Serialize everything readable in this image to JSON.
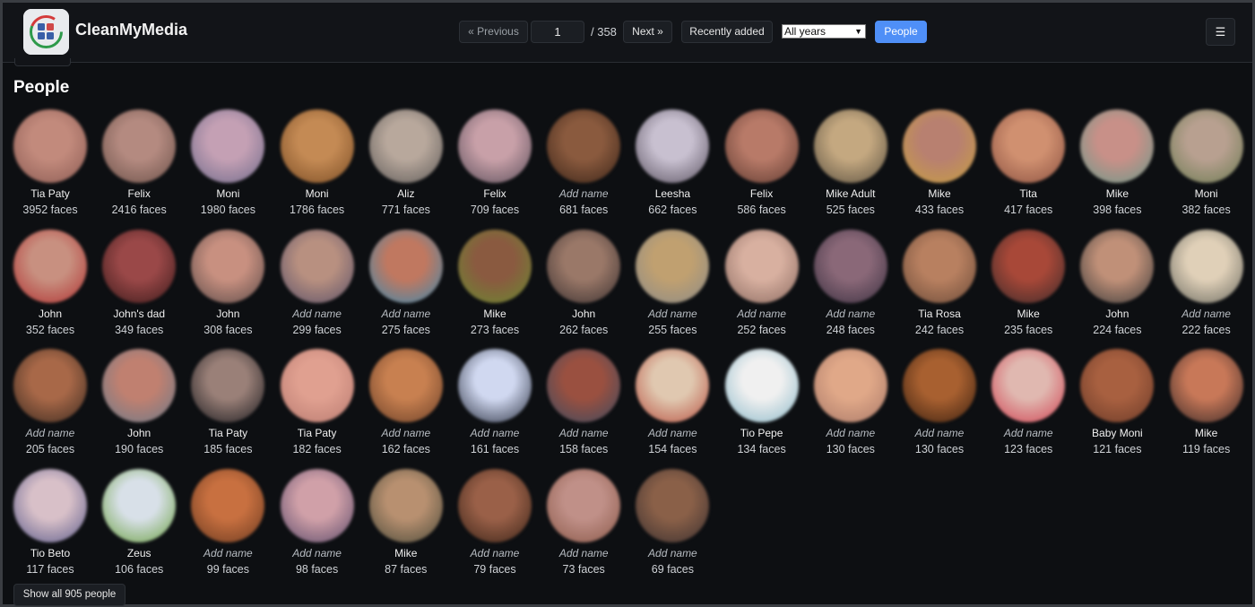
{
  "app": {
    "title": "CleanMyMedia",
    "logo_icon": "app-logo-icon"
  },
  "nav": {
    "previous_label": "« Previous",
    "page_value": "1",
    "total_pages": "/ 358",
    "next_label": "Next »",
    "recently_added_label": "Recently added",
    "year_selected": "All years",
    "people_label": "People",
    "menu_icon": "☰"
  },
  "main": {
    "heading": "People",
    "show_all_label": "Show all 905 people"
  },
  "colors": {
    "accent": "#4f8ff7",
    "background": "#0d0f12",
    "surface": "#1b1e23"
  },
  "people": [
    {
      "name": "Tia Paty",
      "faces": "3952 faces",
      "tone": [
        "#c28a7c",
        "#8a5a52"
      ]
    },
    {
      "name": "Felix",
      "faces": "2416 faces",
      "tone": [
        "#b48a80",
        "#6a5048"
      ]
    },
    {
      "name": "Moni",
      "faces": "1980 faces",
      "tone": [
        "#c4a0b4",
        "#6e6a8a"
      ]
    },
    {
      "name": "Moni",
      "faces": "1786 faces",
      "tone": [
        "#c48a54",
        "#7a4c24"
      ]
    },
    {
      "name": "Aliz",
      "faces": "771 faces",
      "tone": [
        "#b8a89c",
        "#5e5a58"
      ]
    },
    {
      "name": "Felix",
      "faces": "709 faces",
      "tone": [
        "#c8a0a8",
        "#5a4e5a"
      ]
    },
    {
      "name": "",
      "faces": "681 faces",
      "tone": [
        "#8a5a3e",
        "#3a2418"
      ]
    },
    {
      "name": "Leesha",
      "faces": "662 faces",
      "tone": [
        "#c8c0d0",
        "#5a5260"
      ]
    },
    {
      "name": "Felix",
      "faces": "586 faces",
      "tone": [
        "#b87a68",
        "#5e3a30"
      ]
    },
    {
      "name": "Mike Adult",
      "faces": "525 faces",
      "tone": [
        "#c4a880",
        "#5a5040"
      ]
    },
    {
      "name": "Mike",
      "faces": "433 faces",
      "tone": [
        "#b88070",
        "#c8a040"
      ]
    },
    {
      "name": "Tita",
      "faces": "417 faces",
      "tone": [
        "#d09070",
        "#8a5040"
      ]
    },
    {
      "name": "Mike",
      "faces": "398 faces",
      "tone": [
        "#c89088",
        "#6a9a8a"
      ]
    },
    {
      "name": "Moni",
      "faces": "382 faces",
      "tone": [
        "#b8a090",
        "#6a7a50"
      ]
    },
    {
      "name": "John",
      "faces": "352 faces",
      "tone": [
        "#c89080",
        "#b03030"
      ]
    },
    {
      "name": "John's dad",
      "faces": "349 faces",
      "tone": [
        "#9a4848",
        "#3a1a1a"
      ]
    },
    {
      "name": "John",
      "faces": "308 faces",
      "tone": [
        "#c89080",
        "#5a4a48"
      ]
    },
    {
      "name": "",
      "faces": "299 faces",
      "tone": [
        "#b89080",
        "#5a5068"
      ]
    },
    {
      "name": "",
      "faces": "275 faces",
      "tone": [
        "#c07860",
        "#3a8ab0"
      ]
    },
    {
      "name": "Mike",
      "faces": "273 faces",
      "tone": [
        "#8a5a40",
        "#6a8a30"
      ]
    },
    {
      "name": "John",
      "faces": "262 faces",
      "tone": [
        "#9a7868",
        "#3a3030"
      ]
    },
    {
      "name": "",
      "faces": "255 faces",
      "tone": [
        "#c0a070",
        "#8a8a88"
      ]
    },
    {
      "name": "",
      "faces": "252 faces",
      "tone": [
        "#d8b0a0",
        "#8a6a60"
      ]
    },
    {
      "name": "",
      "faces": "248 faces",
      "tone": [
        "#8a6878",
        "#3a3040"
      ]
    },
    {
      "name": "Tia Rosa",
      "faces": "242 faces",
      "tone": [
        "#b88060",
        "#6a4a38"
      ]
    },
    {
      "name": "Mike",
      "faces": "235 faces",
      "tone": [
        "#a84838",
        "#3a2a2a"
      ]
    },
    {
      "name": "John",
      "faces": "224 faces",
      "tone": [
        "#c09078",
        "#3a3a3a"
      ]
    },
    {
      "name": "",
      "faces": "222 faces",
      "tone": [
        "#e0d0b8",
        "#6a6a60"
      ]
    },
    {
      "name": "",
      "faces": "205 faces",
      "tone": [
        "#a86848",
        "#3a2a20"
      ]
    },
    {
      "name": "John",
      "faces": "190 faces",
      "tone": [
        "#c08070",
        "#6a7a8a"
      ]
    },
    {
      "name": "Tia Paty",
      "faces": "185 faces",
      "tone": [
        "#9a8078",
        "#1a1a1e"
      ]
    },
    {
      "name": "Tia Paty",
      "faces": "182 faces",
      "tone": [
        "#e0a090",
        "#b87a70"
      ]
    },
    {
      "name": "",
      "faces": "162 faces",
      "tone": [
        "#c88050",
        "#6a4028"
      ]
    },
    {
      "name": "",
      "faces": "161 faces",
      "tone": [
        "#d0d8f0",
        "#2a3040"
      ]
    },
    {
      "name": "",
      "faces": "158 faces",
      "tone": [
        "#9a5040",
        "#3a4a60"
      ]
    },
    {
      "name": "",
      "faces": "154 faces",
      "tone": [
        "#e0c8b0",
        "#b85040"
      ]
    },
    {
      "name": "Tio Pepe",
      "faces": "134 faces",
      "tone": [
        "#f0f0f0",
        "#8ab8c8"
      ]
    },
    {
      "name": "",
      "faces": "130 faces",
      "tone": [
        "#e0a888",
        "#a87868"
      ]
    },
    {
      "name": "",
      "faces": "130 faces",
      "tone": [
        "#a86030",
        "#3a2010"
      ]
    },
    {
      "name": "",
      "faces": "123 faces",
      "tone": [
        "#e0b8b0",
        "#d04050"
      ]
    },
    {
      "name": "Baby Moni",
      "faces": "121 faces",
      "tone": [
        "#a86040",
        "#6a3a28"
      ]
    },
    {
      "name": "Mike",
      "faces": "119 faces",
      "tone": [
        "#c87858",
        "#3a2a28"
      ]
    },
    {
      "name": "Tio Beto",
      "faces": "117 faces",
      "tone": [
        "#d8c0c8",
        "#5a5a8a"
      ]
    },
    {
      "name": "Zeus",
      "faces": "106 faces",
      "tone": [
        "#d8e0e8",
        "#6aa040"
      ]
    },
    {
      "name": "",
      "faces": "99 faces",
      "tone": [
        "#c87040",
        "#6a3a20"
      ]
    },
    {
      "name": "",
      "faces": "98 faces",
      "tone": [
        "#d0a0a8",
        "#5a4a6a"
      ]
    },
    {
      "name": "Mike",
      "faces": "87 faces",
      "tone": [
        "#b89070",
        "#4a4a3a"
      ]
    },
    {
      "name": "",
      "faces": "79 faces",
      "tone": [
        "#9a6048",
        "#3a2418"
      ]
    },
    {
      "name": "",
      "faces": "73 faces",
      "tone": [
        "#c09088",
        "#8a5848"
      ]
    },
    {
      "name": "",
      "faces": "69 faces",
      "tone": [
        "#8a6048",
        "#3a3030"
      ]
    }
  ],
  "add_name_label": "Add name"
}
